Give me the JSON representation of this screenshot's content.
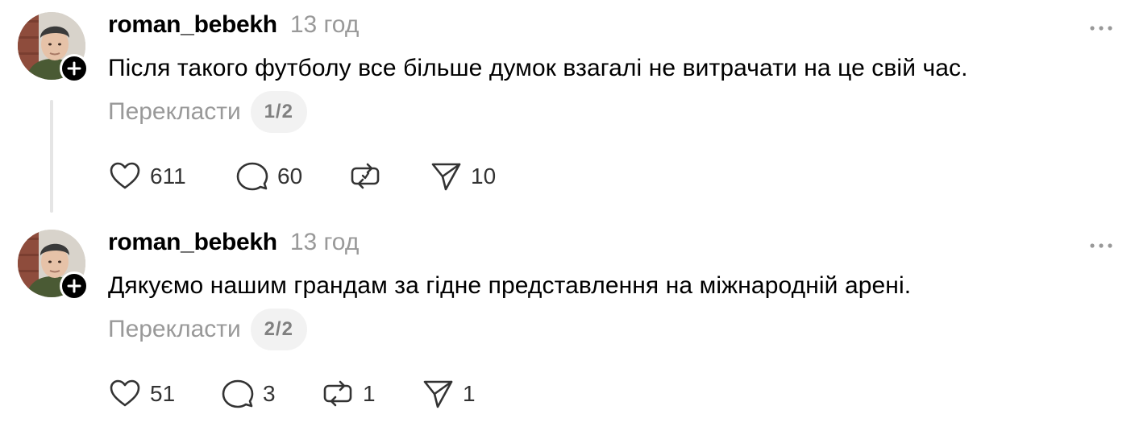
{
  "posts": [
    {
      "username": "roman_bebekh",
      "time": "13 год",
      "text": "Після такого футболу все більше думок взагалі не витрачати на це свій час.",
      "translate_label": "Перекласти",
      "page_indicator": "1/2",
      "likes": "611",
      "replies": "60",
      "reposts": "",
      "shares": "10"
    },
    {
      "username": "roman_bebekh",
      "time": "13 год",
      "text": "Дякуємо нашим грандам за гідне представлення на міжнародній арені.",
      "translate_label": "Перекласти",
      "page_indicator": "2/2",
      "likes": "51",
      "replies": "3",
      "reposts": "1",
      "shares": "1"
    }
  ],
  "icons": {
    "avatar": "profile-photo",
    "follow": "plus-icon",
    "more": "more-horizontal-icon",
    "like": "heart-icon",
    "reply": "comment-bubble-icon",
    "repost": "repost-icon",
    "share": "send-icon"
  },
  "colors": {
    "text": "#000000",
    "muted": "#999999",
    "pill_bg": "#f2f2f2",
    "thread_line": "#e5e5e5"
  }
}
